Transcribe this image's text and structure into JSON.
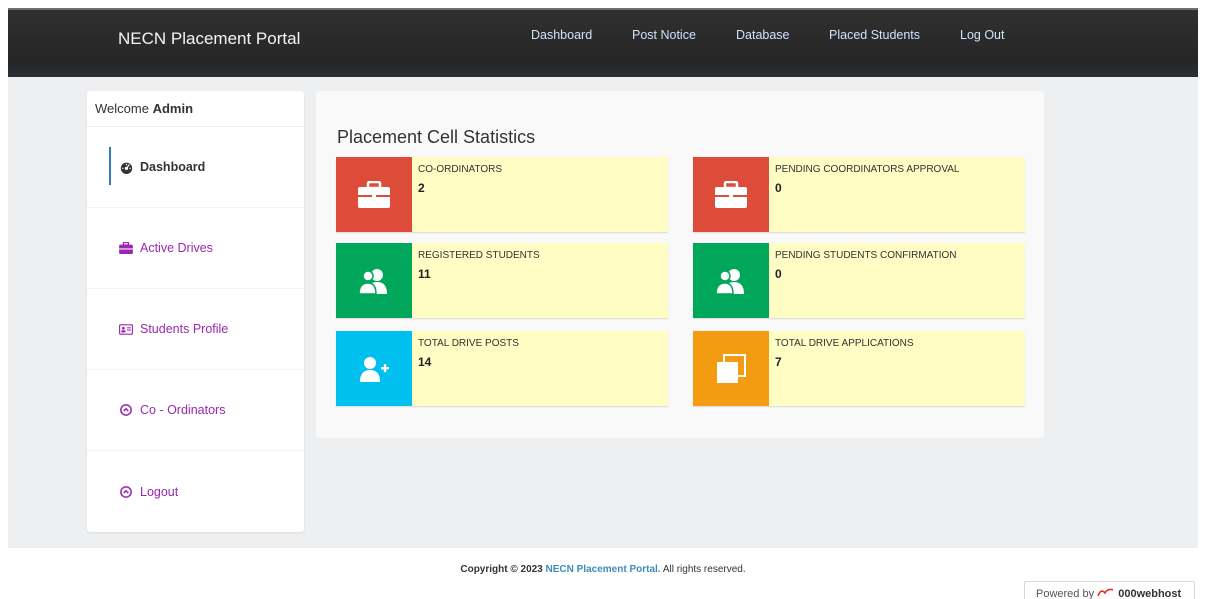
{
  "navbar": {
    "brand": "NECN Placement Portal",
    "links": [
      "Dashboard",
      "Post Notice",
      "Database",
      "Placed Students",
      "Log Out"
    ]
  },
  "sidebar": {
    "welcome_prefix": "Welcome",
    "welcome_user": "Admin",
    "items": [
      {
        "label": "Dashboard",
        "icon": "dashboard-icon",
        "active": true
      },
      {
        "label": "Active Drives",
        "icon": "briefcase-icon",
        "active": false
      },
      {
        "label": "Students Profile",
        "icon": "id-card-icon",
        "active": false
      },
      {
        "label": "Co - Ordinators",
        "icon": "circle-chevron-icon",
        "active": false
      },
      {
        "label": "Logout",
        "icon": "circle-chevron-icon",
        "active": false
      }
    ]
  },
  "main": {
    "title": "Placement Cell Statistics",
    "stats": [
      {
        "label": "CO-ORDINATORS",
        "value": "2",
        "icon": "briefcase-icon",
        "color": "#dd4b39"
      },
      {
        "label": "PENDING COORDINATORS APPROVAL",
        "value": "0",
        "icon": "briefcase-icon",
        "color": "#dd4b39"
      },
      {
        "label": "REGISTERED STUDENTS",
        "value": "11",
        "icon": "users-icon",
        "color": "#00a65a"
      },
      {
        "label": "PENDING STUDENTS CONFIRMATION",
        "value": "0",
        "icon": "users-icon",
        "color": "#00a65a"
      },
      {
        "label": "TOTAL DRIVE POSTS",
        "value": "14",
        "icon": "user-plus-icon",
        "color": "#00c0ef"
      },
      {
        "label": "TOTAL DRIVE APPLICATIONS",
        "value": "7",
        "icon": "copy-icon",
        "color": "#f39c12"
      }
    ]
  },
  "footer": {
    "prefix": "Copyright © 2023",
    "link": "NECN Placement Portal.",
    "suffix": "All rights reserved."
  },
  "badge": {
    "prefix": "Powered by",
    "host": "000webhost"
  },
  "colors": {
    "navbar": "#2b2b2b",
    "link_purple": "#9c27b0",
    "stat_bg": "#fffcc4"
  }
}
